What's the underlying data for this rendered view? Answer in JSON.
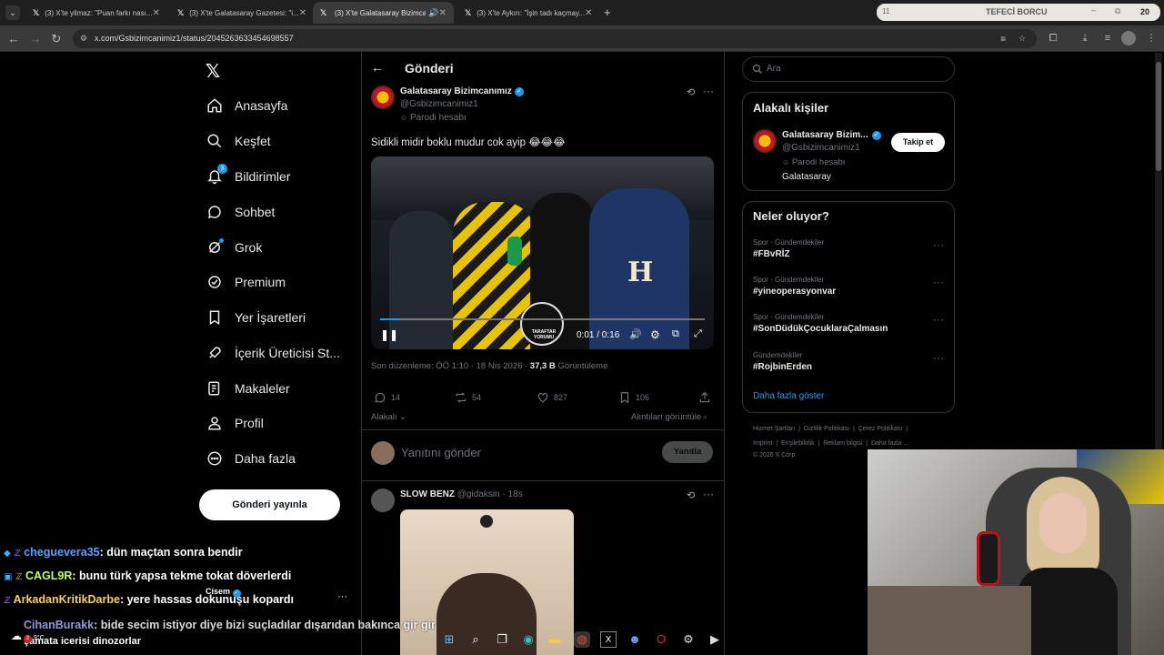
{
  "browser": {
    "tabs": [
      {
        "title": "(3) X'te yilmaz: \"Puan farkı nası...",
        "icon": "x-icon"
      },
      {
        "title": "(3) X'te Galatasaray Gazetesi: \"i...",
        "icon": "x-icon"
      },
      {
        "title": "(3) X'te Galatasaray Bizimca...",
        "icon": "x-icon",
        "active": true
      },
      {
        "title": "(3) X'te Aykırı: \"İşin tadı kaçmay...",
        "icon": "x-icon"
      }
    ],
    "url": "x.com/Gsbizimcanimiz1/status/2045263633454698557",
    "media_widget": {
      "badge": "11",
      "title": "TEFECİ BORCU",
      "count": "20"
    }
  },
  "sidebar": {
    "items": [
      {
        "label": "Anasayfa",
        "icon": "home-icon"
      },
      {
        "label": "Keşfet",
        "icon": "search-icon"
      },
      {
        "label": "Bildirimler",
        "icon": "bell-icon",
        "badge": "3"
      },
      {
        "label": "Sohbet",
        "icon": "chat-icon"
      },
      {
        "label": "Grok",
        "icon": "grok-icon"
      },
      {
        "label": "Premium",
        "icon": "premium-icon"
      },
      {
        "label": "Yer İşaretleri",
        "icon": "bookmark-icon"
      },
      {
        "label": "İçerik Üreticisi St...",
        "icon": "rocket-icon"
      },
      {
        "label": "Makaleler",
        "icon": "article-icon"
      },
      {
        "label": "Profil",
        "icon": "person-icon"
      },
      {
        "label": "Daha fazla",
        "icon": "more-circle-icon"
      }
    ],
    "post_button": "Gönderi yayınla"
  },
  "main": {
    "header": "Gönderi",
    "post": {
      "author": "Galatasaray Bizimcanımız",
      "handle": "@Gsbizimcanimiz1",
      "parody": "Parodi hesabı",
      "text": "Sidikli midir boklu mudur cok ayip 😂😂😂",
      "video_time": "0:01 / 0:16",
      "video_overlay": "TARAFTAR YORUMU",
      "edited": "Son düzenleme: ÖÖ 1:10 · 18 Nis 2026 ·",
      "views": "37,3 B",
      "views_label": "Görüntüleme",
      "replies": "14",
      "reposts": "54",
      "likes": "827",
      "bookmarks": "106",
      "relevant": "Alakalı",
      "quotes": "Alıntıları görüntüle"
    },
    "reply_placeholder": "Yanıtını gönder",
    "reply_button": "Yanıtla",
    "reply": {
      "author": "SLOW BENZ",
      "handle": "@gidaksin",
      "time": "· 18s"
    }
  },
  "right": {
    "search_placeholder": "Ara",
    "relevant_title": "Alakalı kişiler",
    "person": {
      "name": "Galatasaray Bizim...",
      "handle": "@Gsbizimcanimiz1",
      "parody": "Parodi hesabı",
      "bio": "Galatasaray",
      "follow": "Takip et"
    },
    "trends_title": "Neler oluyor?",
    "trends": [
      {
        "cat": "Spor · Gündemdekiler",
        "tag": "#FBvRİZ"
      },
      {
        "cat": "Spor · Gündemdekiler",
        "tag": "#yineoperasyonvar"
      },
      {
        "cat": "Spor · Gündemdekiler",
        "tag": "#SonDüdükÇocuklaraÇalmasın"
      },
      {
        "cat": "Gündemdekiler",
        "tag": "#RojbinErden"
      }
    ],
    "show_more": "Daha fazla göster",
    "footer1": [
      "Hizmet Şartları",
      "Gizlilik Politikası",
      "Çerez Politikası"
    ],
    "footer2": [
      "Imprint",
      "Erişilebilirlik",
      "Reklam bilgisi",
      "Daha fazla ..."
    ],
    "copyright": "© 2026 X Corp."
  },
  "chat": [
    {
      "user": "cheguevera35",
      "color": "#5aa0ff",
      "msg": ": dün maçtan sonra bendir"
    },
    {
      "user": "CAGL9R",
      "color": "#c8ff4a",
      "msg": ": bunu türk yapsa tekme tokat döverlerdi"
    },
    {
      "user": "ArkadanKritikDarbe",
      "color": "#ffcf4a",
      "msg": ": yere hassas dokunuşu kopardı"
    },
    {
      "user": "CihanBurakk",
      "color": "#b0b0ff",
      "msg": ": bide secim istiyor diye bizi suçladılar dışarıdan bakınca gir gir"
    },
    {
      "user": "",
      "color": "#fff",
      "msg": "şamata icerisi dinozorlar"
    }
  ],
  "chat_overlay_name": "Cisem",
  "weather": {
    "temp": "9°C",
    "badge": "2"
  }
}
